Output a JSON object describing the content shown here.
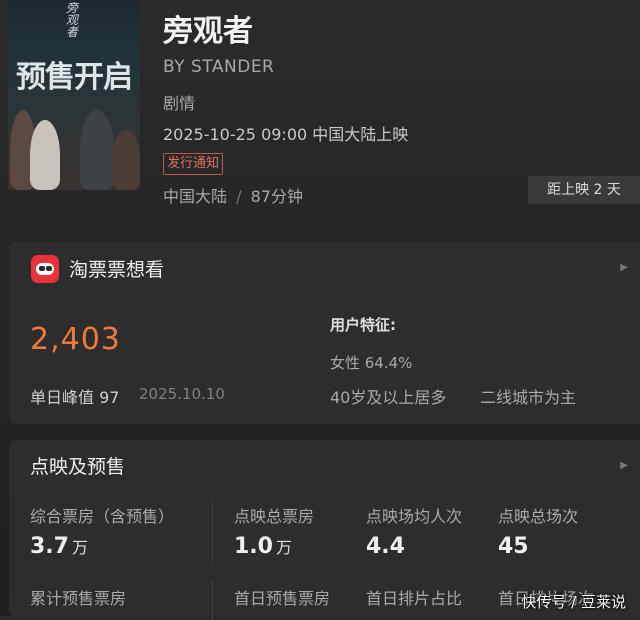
{
  "poster": {
    "small_text": "旁观者",
    "big_text": "预售开启"
  },
  "movie": {
    "title": "旁观者",
    "subtitle": "BY STANDER",
    "genre": "剧情",
    "release": "2025-10-25 09:00 中国大陆上映",
    "badge": "发行通知",
    "region": "中国大陆",
    "separator": "/",
    "duration": "87分钟",
    "countdown": "距上映 2 天"
  },
  "want": {
    "title": "淘票票想看",
    "count": "2,403",
    "peak_label": "单日峰值 97",
    "peak_date": "2025.10.10",
    "features_title": "用户特征:",
    "female": "女性 64.4%",
    "age": "40岁及以上居多",
    "city": "二线城市为主"
  },
  "presale": {
    "title": "点映及预售",
    "stats": [
      {
        "label": "综合票房（含预售）",
        "value": "3.7",
        "unit": "万"
      },
      {
        "label": "点映总票房",
        "value": "1.0",
        "unit": "万"
      },
      {
        "label": "点映场均人次",
        "value": "4.4",
        "unit": ""
      },
      {
        "label": "点映总场次",
        "value": "45",
        "unit": ""
      }
    ],
    "row2": [
      "累计预售票房",
      "首日预售票房",
      "首日排片占比",
      "首日排片场次"
    ]
  },
  "watermark": "快传号 / 豆莱说",
  "colors": {
    "accent_orange": "#f07a3a",
    "badge_red": "#c2584b",
    "logo_red": "#e8333a"
  }
}
